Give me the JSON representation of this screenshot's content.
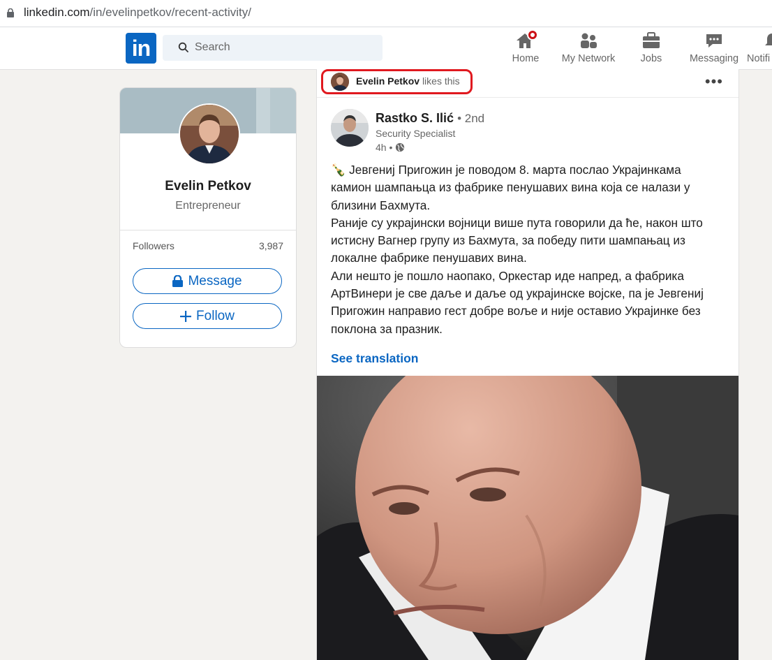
{
  "browser": {
    "url_domain": "linkedin.com",
    "url_path": "/in/evelinpetkov/recent-activity/"
  },
  "nav": {
    "logo": "in",
    "search_placeholder": "Search",
    "items": [
      {
        "label": "Home",
        "icon": "home-icon",
        "badge": true
      },
      {
        "label": "My Network",
        "icon": "network-icon"
      },
      {
        "label": "Jobs",
        "icon": "briefcase-icon"
      },
      {
        "label": "Messaging",
        "icon": "messaging-icon"
      },
      {
        "label": "Notifi",
        "icon": "bell-icon"
      }
    ]
  },
  "profile": {
    "name": "Evelin Petkov",
    "headline": "Entrepreneur",
    "followers_label": "Followers",
    "followers_count": "3,987",
    "message_button": "Message",
    "follow_button": "Follow"
  },
  "activity": {
    "actor": "Evelin Petkov",
    "action": "likes this",
    "more": "•••"
  },
  "post": {
    "author_name": "Rastko S. Ilić",
    "author_degree": "• 2nd",
    "author_title": "Security Specialist",
    "time": "4h •",
    "body_lines": [
      "🍾 Јевгениј Пригожин је поводом 8. марта послао Украјинкама",
      "камион шампањца из фабрике пенушавих вина која се налази у",
      "близини Бахмута.",
      "Раније су украјински војници више пута говорили да ће, након што",
      "истисну Вагнер групу из Бахмута, за победу пити шампањац из",
      "локалне фабрике пенушавих вина.",
      "Али нешто је пошло наопако, Оркестар иде напред, а фабрика",
      "АртВинери је све даље и даље од украјинске војске, па је Јевгениј",
      "Пригожин направио гест добре воље и није оставио Украјинке без",
      "поклона за празник."
    ],
    "see_translation": "See translation"
  },
  "colors": {
    "linkedin_blue": "#0a66c2",
    "highlight_red": "#e0191f",
    "page_bg": "#f3f2ef"
  }
}
